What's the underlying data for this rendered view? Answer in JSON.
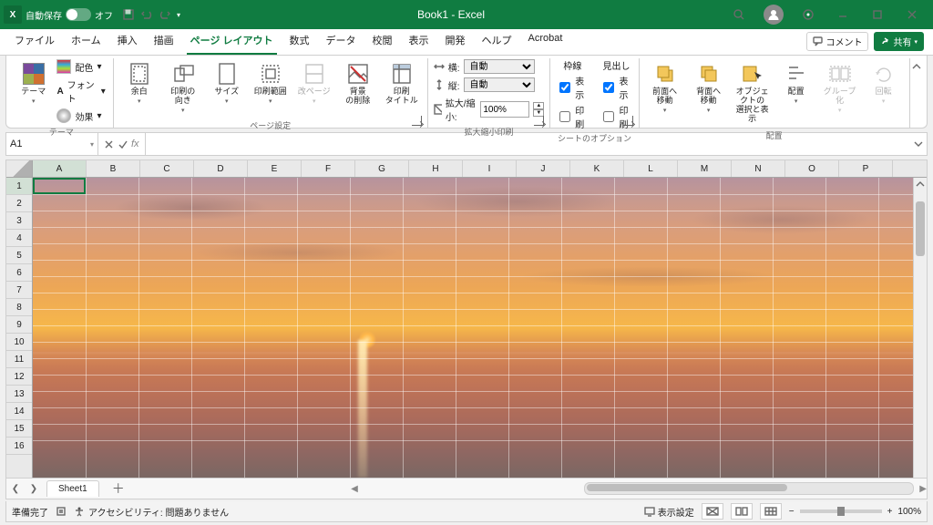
{
  "title_bar": {
    "app_icon_letter": "X",
    "autosave": {
      "label": "自動保存",
      "state_text": "オフ"
    },
    "doc_title": "Book1  -  Excel"
  },
  "tabs": {
    "items": [
      "ファイル",
      "ホーム",
      "挿入",
      "描画",
      "ページ レイアウト",
      "数式",
      "データ",
      "校閲",
      "表示",
      "開発",
      "ヘルプ",
      "Acrobat"
    ],
    "active_index": 4,
    "comment_btn": "コメント",
    "share_btn": "共有"
  },
  "ribbon": {
    "themes": {
      "label": "テーマ",
      "theme_btn": "テーマ",
      "colors": "配色",
      "fonts": "フォント",
      "effects": "効果"
    },
    "page_setup": {
      "label": "ページ設定",
      "margins": "余白",
      "orientation": "印刷の\n向き",
      "size": "サイズ",
      "print_area": "印刷範囲",
      "breaks": "改ページ",
      "background": "背景\nの削除",
      "titles": "印刷\nタイトル"
    },
    "scale": {
      "label": "拡大縮小印刷",
      "width": "横:",
      "height": "縦:",
      "auto": "自動",
      "ratio": "拡大/縮小:",
      "ratio_value": "100%"
    },
    "sheet_opts": {
      "label": "シートのオプション",
      "gridlines": "枠線",
      "headings": "見出し",
      "view": "表示",
      "print": "印刷",
      "grid_view": true,
      "grid_print": false,
      "head_view": true,
      "head_print": false
    },
    "arrange": {
      "label": "配置",
      "forward": "前面へ\n移動",
      "backward": "背面へ\n移動",
      "pane": "オブジェクトの\n選択と表示",
      "align": "配置",
      "group": "グループ化",
      "rotate": "回転"
    }
  },
  "formula_bar": {
    "name": "A1",
    "fx": "fx"
  },
  "grid": {
    "columns": [
      "A",
      "B",
      "C",
      "D",
      "E",
      "F",
      "G",
      "H",
      "I",
      "J",
      "K",
      "L",
      "M",
      "N",
      "O",
      "P"
    ],
    "rows": [
      1,
      2,
      3,
      4,
      5,
      6,
      7,
      8,
      9,
      10,
      11,
      12,
      13,
      14,
      15,
      16
    ],
    "active_col": 0,
    "active_row": 0
  },
  "sheet_tabs": {
    "active": "Sheet1"
  },
  "status": {
    "ready": "準備完了",
    "accessibility": "アクセシビリティ: 問題ありません",
    "display_settings": "表示設定",
    "zoom": "100%"
  }
}
